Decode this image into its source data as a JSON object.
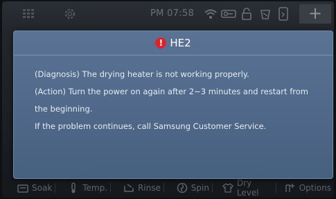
{
  "status_bar": {
    "time": "PM 07:58",
    "icons": [
      "grid-icon",
      "gear-icon",
      "wifi-icon",
      "key-lock-icon",
      "padlock-icon",
      "cup-icon",
      "phone-icon"
    ],
    "add_label": "+"
  },
  "dialog": {
    "code": "HE2",
    "lines": [
      "(Diagnosis) The drying heater is not working properly.",
      "(Action) Turn the power on again after 2~3 minutes and restart from",
      "the beginning.",
      "If the problem continues, call Samsung Customer Service."
    ],
    "accent_color": "#d9252a"
  },
  "bottom_menu": {
    "items": [
      {
        "label": "Soak",
        "icon": "soak-icon"
      },
      {
        "label": "Temp.",
        "icon": "thermometer-icon"
      },
      {
        "label": "Rinse",
        "icon": "rinse-icon"
      },
      {
        "label": "Spin",
        "icon": "spin-icon"
      },
      {
        "label": "Dry Level",
        "icon": "shirt-icon"
      },
      {
        "label": "Options",
        "icon": "options-icon"
      }
    ]
  }
}
